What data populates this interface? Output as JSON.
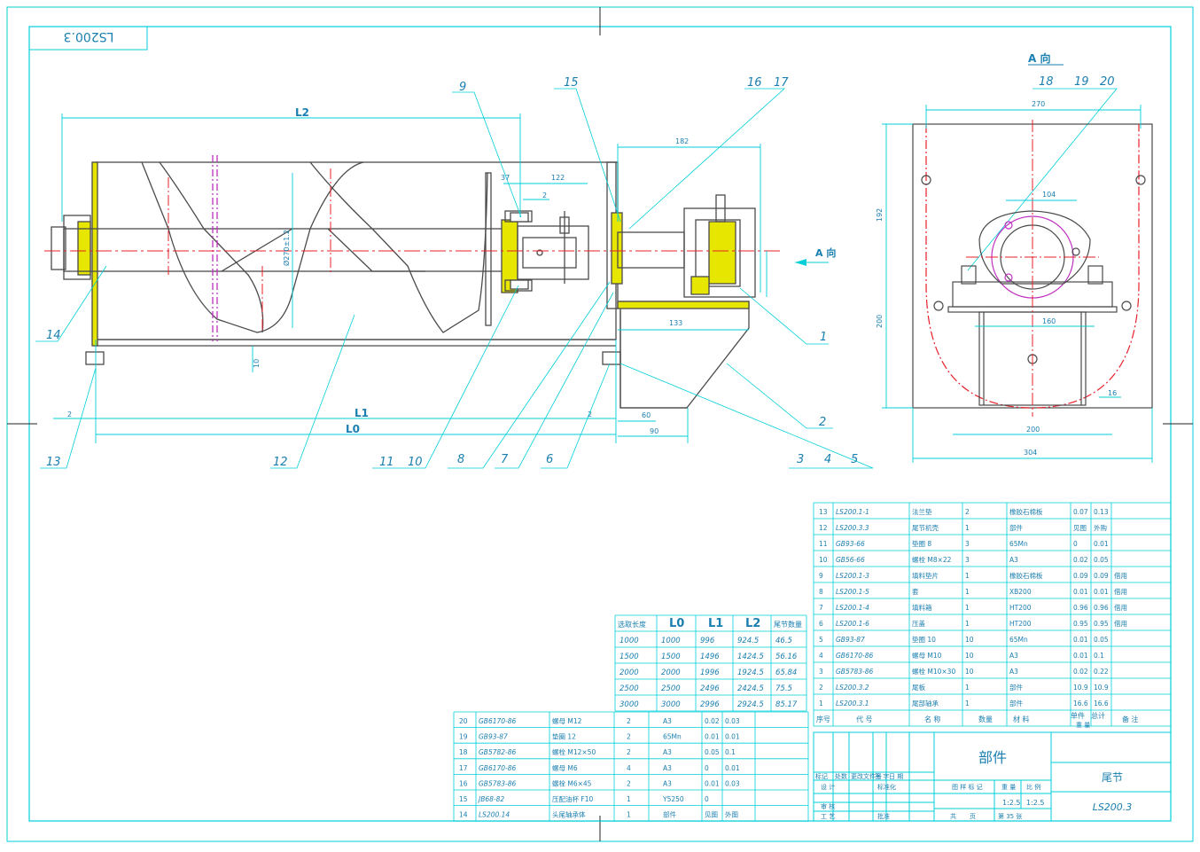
{
  "stamp": "LS200.3",
  "colors": {
    "frame": "#00cfd8",
    "line": "#4a4a4a",
    "center": "#e8202a",
    "hidden": "#c030c0",
    "yellow": "#e6e600",
    "text": "#1a7fb0"
  },
  "callouts": [
    "9",
    "15",
    "16",
    "17",
    "14",
    "13",
    "12",
    "11",
    "10",
    "8",
    "7",
    "6",
    "1",
    "2",
    "3",
    "4",
    "5",
    "18",
    "19",
    "20"
  ],
  "dims": {
    "L2": "L2",
    "L1": "L1",
    "L0": "L0",
    "d182": "182",
    "d37": "37",
    "d122": "122",
    "d2a": "2",
    "d2b": "2",
    "d2c": "2",
    "d10": "10",
    "d133": "133",
    "d60": "60",
    "d90": "90",
    "shaft": "Ø270±1.2",
    "d270": "270",
    "d192": "192",
    "d200v": "200",
    "d104": "104",
    "d160": "160",
    "d200h": "200",
    "d304": "304",
    "d16": "16"
  },
  "view_label": "A 向",
  "view_arrow_label": "A 向",
  "length_table": {
    "headers": [
      "选取长度",
      "L0",
      "L1",
      "L2",
      "尾节数量"
    ],
    "rows": [
      [
        "1000",
        "1000",
        "996",
        "924.5",
        "46.5"
      ],
      [
        "1500",
        "1500",
        "1496",
        "1424.5",
        "56.16"
      ],
      [
        "2000",
        "2000",
        "1996",
        "1924.5",
        "65.84"
      ],
      [
        "2500",
        "2500",
        "2496",
        "2424.5",
        "75.5"
      ],
      [
        "3000",
        "3000",
        "2996",
        "2924.5",
        "85.17"
      ]
    ]
  },
  "parts_right": [
    [
      "13",
      "LS200.1-1",
      "法兰垫",
      "2",
      "橡胶石棉板",
      "0.07",
      "0.13",
      ""
    ],
    [
      "12",
      "LS200.3.3",
      "尾节机壳",
      "1",
      "部件",
      "见图",
      "外购"
    ],
    [
      "11",
      "GB93-66",
      "垫圈 8",
      "3",
      "65Mn",
      "0",
      "0.01",
      ""
    ],
    [
      "10",
      "GB56-66",
      "螺栓 M8×22",
      "3",
      "A3",
      "0.02",
      "0.05",
      ""
    ],
    [
      "9",
      "LS200.1-3",
      "填料垫片",
      "1",
      "橡胶石棉板",
      "0.09",
      "0.09",
      "借用"
    ],
    [
      "8",
      "LS200.1-5",
      "套",
      "1",
      "XB200",
      "0.01",
      "0.01",
      "借用"
    ],
    [
      "7",
      "LS200.1-4",
      "填料箱",
      "1",
      "HT200",
      "0.96",
      "0.96",
      "借用"
    ],
    [
      "6",
      "LS200.1-6",
      "压盖",
      "1",
      "HT200",
      "0.95",
      "0.95",
      "借用"
    ],
    [
      "5",
      "GB93-87",
      "垫圈 10",
      "10",
      "65Mn",
      "0.01",
      "0.05",
      ""
    ],
    [
      "4",
      "GB6170-86",
      "螺母 M10",
      "10",
      "A3",
      "0.01",
      "0.1",
      ""
    ],
    [
      "3",
      "GB5783-86",
      "螺栓 M10×30",
      "10",
      "A3",
      "0.02",
      "0.22",
      ""
    ],
    [
      "2",
      "LS200.3.2",
      "尾板",
      "1",
      "部件",
      "10.9",
      "10.9",
      ""
    ],
    [
      "1",
      "LS200.3.1",
      "尾部轴承",
      "1",
      "部件",
      "16.6",
      "16.6",
      ""
    ]
  ],
  "parts_right_header": [
    "序号",
    "代 号",
    "名 称",
    "数量",
    "材 料",
    "单件",
    "总计",
    "备 注"
  ],
  "parts_right_subheader": "重 量",
  "parts_left": [
    [
      "20",
      "GB6170-86",
      "螺母 M12",
      "2",
      "A3",
      "0.02",
      "0.03"
    ],
    [
      "19",
      "GB93-87",
      "垫圈 12",
      "2",
      "65Mn",
      "0.01",
      "0.01"
    ],
    [
      "18",
      "GB5782-86",
      "螺栓 M12×50",
      "2",
      "A3",
      "0.05",
      "0.1"
    ],
    [
      "17",
      "GB6170-86",
      "螺母 M6",
      "4",
      "A3",
      "0",
      "0.01"
    ],
    [
      "16",
      "GB5783-86",
      "螺栓 M6×45",
      "2",
      "A3",
      "0.01",
      "0.03"
    ],
    [
      "15",
      "JB68-82",
      "压配油杯 F10",
      "1",
      "Y5250",
      "0",
      ""
    ],
    [
      "14",
      "LS200.14",
      "头尾轴承体",
      "1",
      "部件",
      "见图",
      "外图"
    ]
  ],
  "title_block": {
    "part_type": "部件",
    "name": "尾节",
    "drawing_no": "LS200.3",
    "scale": "1:2.5",
    "scale_label": "比 例",
    "weight_label": "重 量",
    "stage_label": "图 样 标 记",
    "sheets": "第 35 张",
    "sheet_word": "共",
    "page_word": "页",
    "r1": [
      "标记",
      "处数",
      "更改文件号",
      "签 字",
      "日 期"
    ],
    "design": "设 计",
    "std": "标准化",
    "check": "审 核",
    "process": "工 艺",
    "date": "日 期",
    "approve": "批准"
  }
}
